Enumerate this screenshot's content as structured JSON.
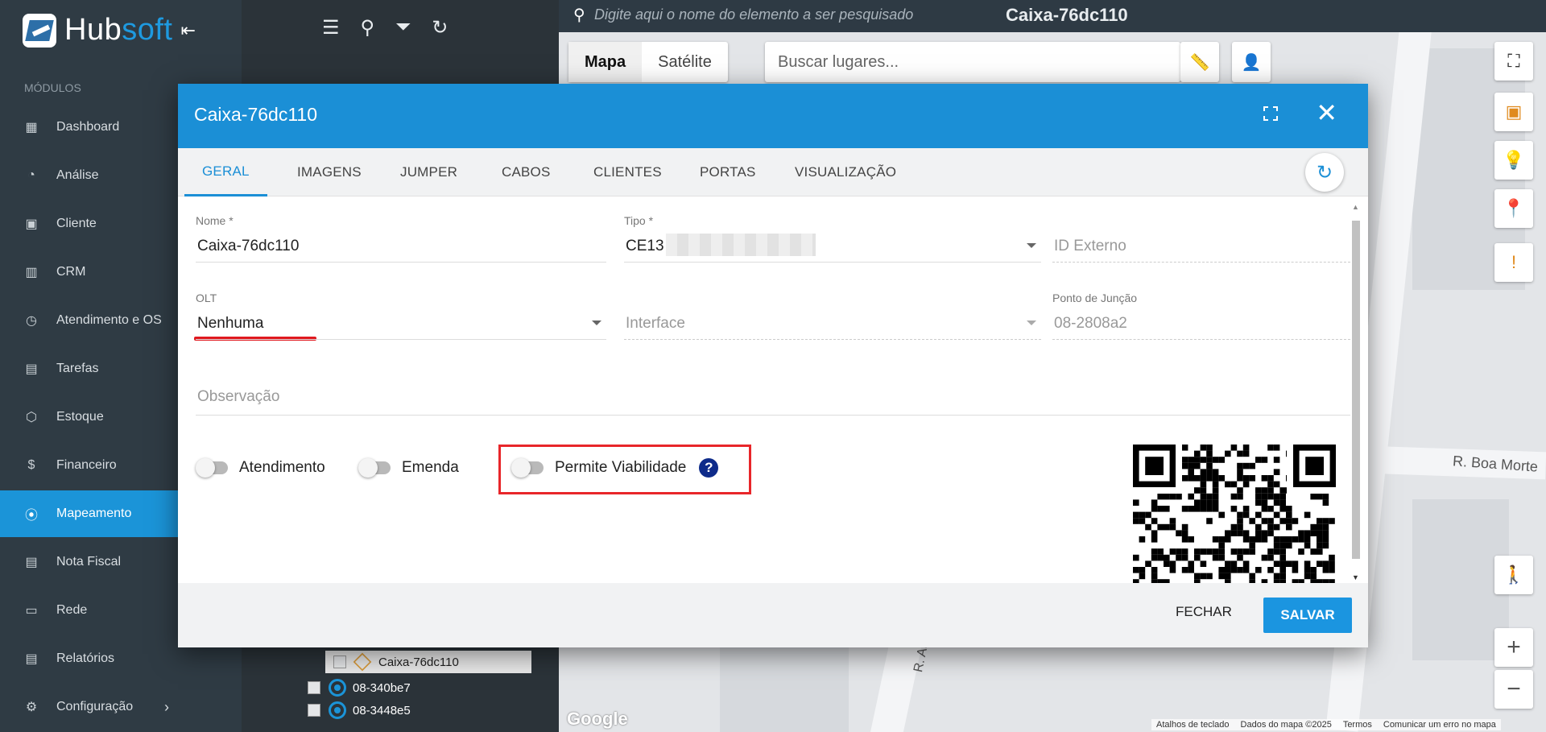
{
  "app": {
    "brand_left": "Hub",
    "brand_right": "soft"
  },
  "sidebar": {
    "section_label": "MÓDULOS",
    "items": [
      {
        "label": "Dashboard",
        "icon": "dashboard-icon"
      },
      {
        "label": "Análise",
        "icon": "pie-chart-icon"
      },
      {
        "label": "Cliente",
        "icon": "contact-card-icon"
      },
      {
        "label": "CRM",
        "icon": "kanban-icon"
      },
      {
        "label": "Atendimento e OS",
        "icon": "calendar-clock-icon"
      },
      {
        "label": "Tarefas",
        "icon": "calendar-tasks-icon"
      },
      {
        "label": "Estoque",
        "icon": "box-icon"
      },
      {
        "label": "Financeiro",
        "icon": "money-icon"
      },
      {
        "label": "Mapeamento",
        "icon": "map-pin-icon",
        "active": true
      },
      {
        "label": "Nota Fiscal",
        "icon": "invoice-icon"
      },
      {
        "label": "Rede",
        "icon": "server-icon"
      },
      {
        "label": "Relatórios",
        "icon": "report-icon"
      },
      {
        "label": "Configuração",
        "icon": "gear-icon"
      }
    ]
  },
  "tree": {
    "items": [
      {
        "label": "Caixa-76dc110",
        "selected": true
      },
      {
        "label": "08-340be7"
      },
      {
        "label": "08-3448e5"
      }
    ]
  },
  "topbar": {
    "search_placeholder": "Digite aqui o nome do elemento a ser pesquisado",
    "title": "Caixa-76dc110"
  },
  "map": {
    "type_map": "Mapa",
    "type_satellite": "Satélite",
    "places_placeholder": "Buscar lugares...",
    "street_1": "R. Boa Morte",
    "street_2": "R. Atira",
    "google": "Google",
    "footer": [
      "Atalhos de teclado",
      "Dados do mapa ©2025",
      "Termos",
      "Comunicar um erro no mapa"
    ]
  },
  "modal": {
    "title": "Caixa-76dc110",
    "tabs": [
      "GERAL",
      "IMAGENS",
      "JUMPER",
      "CABOS",
      "CLIENTES",
      "PORTAS",
      "VISUALIZAÇÃO"
    ],
    "fields": {
      "nome_label": "Nome *",
      "nome_value": "Caixa-76dc110",
      "tipo_label": "Tipo *",
      "tipo_value": "CE13",
      "id_externo_placeholder": "ID Externo",
      "olt_label": "OLT",
      "olt_value": "Nenhuma",
      "interface_placeholder": "Interface",
      "ponto_label": "Ponto de Junção",
      "ponto_value": "08-2808a2",
      "observacao_placeholder": "Observação"
    },
    "toggles": {
      "atendimento": "Atendimento",
      "emenda": "Emenda",
      "viabilidade": "Permite Viabilidade",
      "help": "?"
    },
    "buttons": {
      "fechar": "FECHAR",
      "salvar": "SALVAR"
    }
  },
  "colors": {
    "accent": "#1b8fd6",
    "sidebar": "#2f3b44",
    "highlight": "#e8262a"
  }
}
